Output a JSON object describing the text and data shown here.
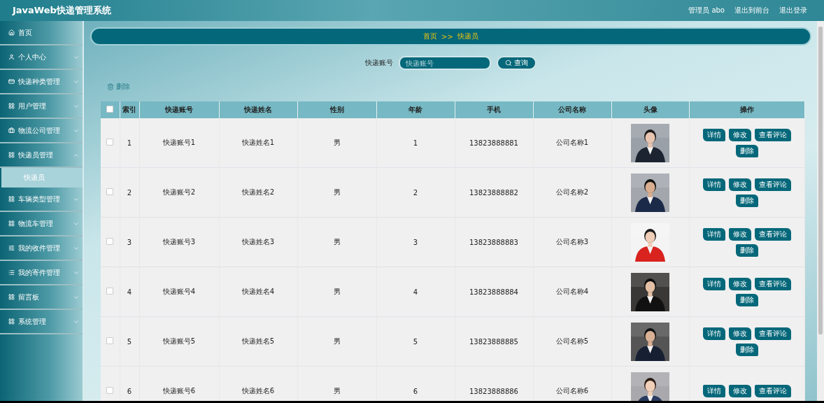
{
  "header": {
    "title": "JavaWeb快递管理系统",
    "user": "管理员 abo",
    "links": [
      "退出到前台",
      "退出登录"
    ]
  },
  "sidebar": {
    "items": [
      {
        "label": "首页"
      },
      {
        "label": "个人中心",
        "expanded": false
      },
      {
        "label": "快递种类管理",
        "expanded": false
      },
      {
        "label": "用户管理",
        "expanded": false
      },
      {
        "label": "物流公司管理",
        "expanded": false
      },
      {
        "label": "快递员管理",
        "expanded": true,
        "children": [
          {
            "label": "快递员",
            "selected": true
          }
        ]
      },
      {
        "label": "车辆类型管理",
        "expanded": false
      },
      {
        "label": "物流车管理",
        "expanded": false
      },
      {
        "label": "我的收件管理",
        "expanded": false
      },
      {
        "label": "我的寄件管理",
        "expanded": false
      },
      {
        "label": "留言板",
        "expanded": false
      },
      {
        "label": "系统管理",
        "expanded": false
      }
    ]
  },
  "breadcrumb": [
    "首页",
    ">>",
    "快递员"
  ],
  "search": {
    "label": "快递账号",
    "placeholder": "快递账号",
    "button": "查询"
  },
  "toolbar": {
    "delete": "删除"
  },
  "table": {
    "select_all_checked": false,
    "columns": [
      "索引",
      "快递账号",
      "快递姓名",
      "性别",
      "年龄",
      "手机",
      "公司名称",
      "头像",
      "操作"
    ],
    "rows": [
      {
        "checked": false,
        "cells": [
          "1",
          "快递账号1",
          "快递姓名1",
          "男",
          "1",
          "13823888881",
          "公司名称1"
        ],
        "photo": {
          "kind": "picture"
        },
        "actions": [
          "详情",
          "修改",
          "查看评论",
          "删除"
        ]
      },
      {
        "checked": false,
        "cells": [
          "2",
          "快递账号2",
          "快递姓名2",
          "男",
          "2",
          "13823888882",
          "公司名称2"
        ],
        "photo": {
          "kind": "picture"
        },
        "actions": [
          "详情",
          "修改",
          "查看评论",
          "删除"
        ]
      },
      {
        "checked": false,
        "cells": [
          "3",
          "快递账号3",
          "快递姓名3",
          "男",
          "3",
          "13823888883",
          "公司名称3"
        ],
        "photo": {
          "kind": "picture"
        },
        "actions": [
          "详情",
          "修改",
          "查看评论",
          "删除"
        ]
      },
      {
        "checked": false,
        "cells": [
          "4",
          "快递账号4",
          "快递姓名4",
          "男",
          "4",
          "13823888884",
          "公司名称4"
        ],
        "photo": {
          "kind": "picture"
        },
        "actions": [
          "详情",
          "修改",
          "查看评论",
          "删除"
        ]
      },
      {
        "checked": false,
        "cells": [
          "5",
          "快递账号5",
          "快递姓名5",
          "男",
          "5",
          "13823888885",
          "公司名称5"
        ],
        "photo": {
          "kind": "picture"
        },
        "actions": [
          "详情",
          "修改",
          "查看评论",
          "删除"
        ]
      },
      {
        "checked": false,
        "cells": [
          "6",
          "快递账号6",
          "快递姓名6",
          "男",
          "6",
          "13823888886",
          "公司名称6"
        ],
        "photo": {
          "kind": "picture"
        },
        "actions": [
          "详情",
          "修改",
          "查看评论"
        ]
      }
    ]
  }
}
